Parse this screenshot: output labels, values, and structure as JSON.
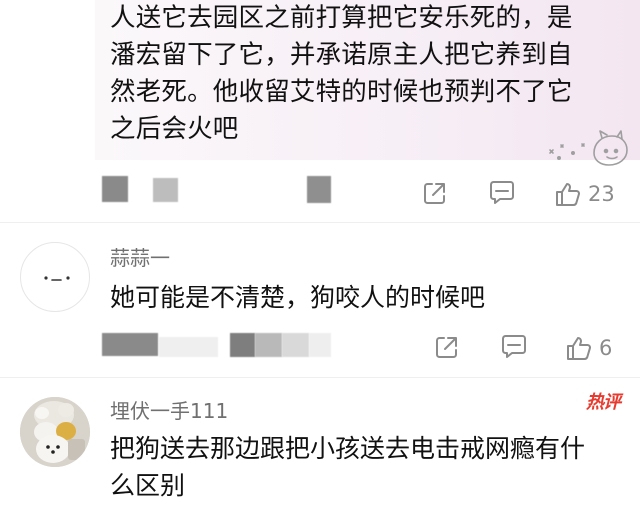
{
  "top_comment": {
    "clipped_line": "",
    "lines": [
      "人送它去园区之前打算把它安乐死的，是",
      "潘宏留下了它，并承诺原主人把它养到自",
      "然老死。他收留艾特的时候也预判不了它",
      "之后会火吧"
    ],
    "like_count": "23"
  },
  "comment_2": {
    "username": "蒜蒜一",
    "text": "她可能是不清楚，狗咬人的时候吧",
    "like_count": "6"
  },
  "comment_3": {
    "username": "埋伏一手111",
    "badge": "热评",
    "lines": [
      "把狗送去那边跟把小孩送去电击戒网瘾有什",
      "么区别"
    ]
  },
  "colors": {
    "text_primary": "#111111",
    "text_secondary": "#707070",
    "icon_gray": "#8b8b8b",
    "hot_red": "#e83a2f",
    "highlight_bg": "#f6ebf5"
  },
  "icons": {
    "share": "share-icon",
    "comment": "comment-icon",
    "like": "like-icon"
  }
}
